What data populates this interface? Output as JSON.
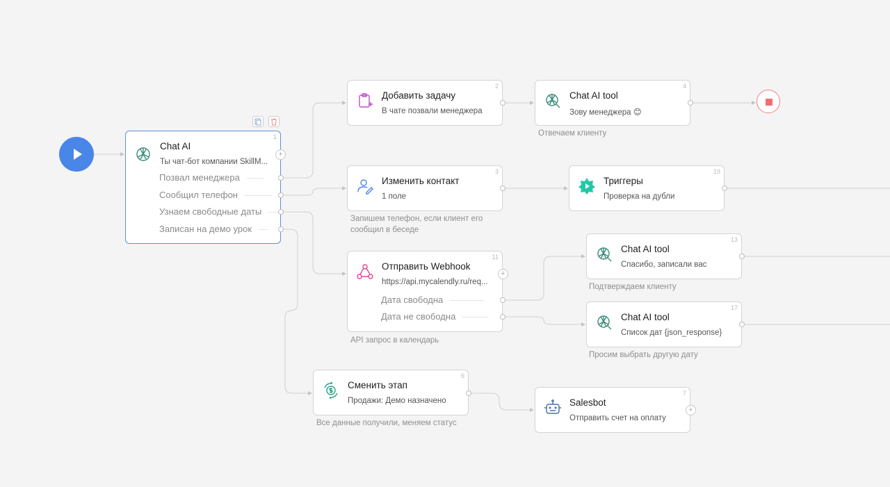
{
  "start": {
    "icon": "play-icon"
  },
  "stop": {
    "icon": "stop-icon"
  },
  "toolbar": {
    "copy_icon": "copy-icon",
    "delete_icon": "trash-icon"
  },
  "nodes": {
    "chat_ai": {
      "number": "1",
      "title": "Chat AI",
      "subtitle": "Ты чат-бот компании SkillM...",
      "outputs": [
        "Позвал менеджера",
        "Сообщил телефон",
        "Узнаем свободные даты",
        "Записан на демо урок"
      ],
      "icon": "openai-icon"
    },
    "add_task": {
      "number": "2",
      "title": "Добавить задачу",
      "subtitle": "В чате позвали менеджера",
      "icon": "clipboard-plus-icon"
    },
    "chat_tool_4": {
      "number": "4",
      "title": "Chat AI tool",
      "subtitle": "Зову менеджера 😊",
      "note": "Отвечаем клиенту",
      "icon": "openai-tool-icon"
    },
    "change_contact": {
      "number": "3",
      "title": "Изменить контакт",
      "subtitle": "1 поле",
      "note": "Запишем телефон, если клиент его сообщил в беседе",
      "icon": "user-edit-icon"
    },
    "triggers": {
      "number": "19",
      "title": "Триггеры",
      "subtitle": "Проверка на дубли",
      "icon": "trigger-icon"
    },
    "webhook": {
      "number": "11",
      "title": "Отправить Webhook",
      "subtitle": "https://api.mycalendly.ru/req...",
      "outputs": [
        "Дата свободна",
        "Дата не свободна"
      ],
      "note": "API запрос в календарь",
      "icon": "webhook-icon"
    },
    "chat_tool_13": {
      "number": "13",
      "title": "Chat AI tool",
      "subtitle": "Спасибо, записали вас",
      "note": "Подтверждаем клиенту",
      "icon": "openai-tool-icon"
    },
    "chat_tool_17": {
      "number": "17",
      "title": "Chat AI tool",
      "subtitle": "Список дат {json_response}",
      "note": "Просим выбрать другую дату",
      "icon": "openai-tool-icon"
    },
    "change_stage": {
      "number": "6",
      "title": "Сменить этап",
      "subtitle": "Продажи: Демо назначено",
      "note": "Все данные получили, меняем статус",
      "icon": "dollar-cycle-icon"
    },
    "salesbot": {
      "number": "7",
      "title": "Salesbot",
      "subtitle": "Отправить счет на оплату",
      "icon": "robot-icon"
    }
  },
  "colors": {
    "accent": "#4a86e8",
    "stop": "#f26d6d",
    "selected_border": "#5b8fd9",
    "trigger": "#22c7a8",
    "webhook": "#e2468c",
    "task": "#c24fc8"
  }
}
